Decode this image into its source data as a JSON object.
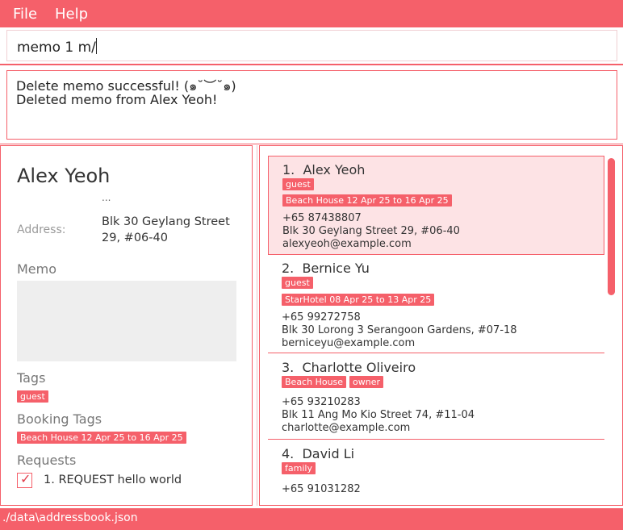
{
  "menu": {
    "file": "File",
    "help": "Help"
  },
  "command": {
    "value": "memo 1 m/"
  },
  "result": {
    "line1": "Delete memo successful! (๑˘︶˘๑)",
    "line2": "Deleted memo from Alex Yeoh!"
  },
  "detail": {
    "name": "Alex Yeoh",
    "ellipsis": "...",
    "address_label": "Address:",
    "address_line1": "Blk 30 Geylang Street",
    "address_line2": "29, #06-40",
    "memo_label": "Memo",
    "tags_label": "Tags",
    "tags": [
      "guest"
    ],
    "booking_label": "Booking Tags",
    "booking_tags": [
      "Beach House 12 Apr 25 to 16 Apr 25"
    ],
    "requests_label": "Requests",
    "requests": [
      {
        "text": "1. REQUEST hello world",
        "checked": true
      }
    ]
  },
  "list": [
    {
      "index": "1.",
      "name": "Alex Yeoh",
      "tags": [
        "guest"
      ],
      "booking": "Beach House 12 Apr 25 to 16 Apr 25",
      "phone": "+65 87438807",
      "address": "Blk 30 Geylang Street 29, #06-40",
      "email": "alexyeoh@example.com",
      "selected": true
    },
    {
      "index": "2.",
      "name": "Bernice Yu",
      "tags": [
        "guest"
      ],
      "booking": "StarHotel 08 Apr 25 to 13 Apr 25",
      "phone": "+65 99272758",
      "address": "Blk 30 Lorong 3 Serangoon Gardens, #07-18",
      "email": "berniceyu@example.com"
    },
    {
      "index": "3.",
      "name": "Charlotte Oliveiro",
      "tags": [
        "Beach House",
        "owner"
      ],
      "phone": "+65 93210283",
      "address": "Blk 11 Ang Mo Kio Street 74, #11-04",
      "email": "charlotte@example.com"
    },
    {
      "index": "4.",
      "name": "David Li",
      "tags": [
        "family"
      ],
      "phone": "+65 91031282"
    }
  ],
  "status": {
    "path": "./data\\addressbook.json"
  },
  "colors": {
    "accent": "#f5606a",
    "selected_bg": "#fde3e5",
    "memo_bg": "#eeeeee"
  }
}
